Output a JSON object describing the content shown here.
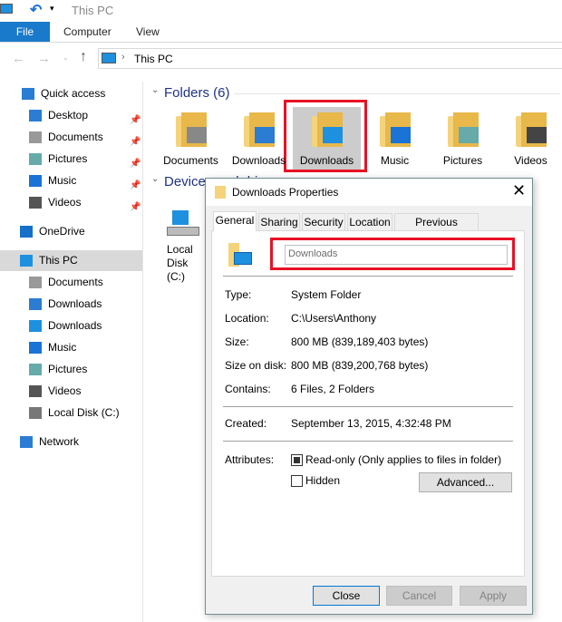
{
  "window": {
    "title": "This PC"
  },
  "ribbon": {
    "tabs": [
      "File",
      "Computer",
      "View"
    ]
  },
  "address": {
    "path": "This PC"
  },
  "nav": [
    {
      "label": "Quick access",
      "icon": "star-icon",
      "color": "#2b7cd3"
    },
    {
      "label": "Desktop",
      "icon": "desktop-arrow-icon",
      "color": "#2b7cd3",
      "pinned": true
    },
    {
      "label": "Documents",
      "icon": "documents-icon",
      "color": "#999",
      "pinned": true
    },
    {
      "label": "Pictures",
      "icon": "pictures-icon",
      "color": "#6aa",
      "pinned": true
    },
    {
      "label": "Music",
      "icon": "music-icon",
      "color": "#1a73d6",
      "pinned": true
    },
    {
      "label": "Videos",
      "icon": "videos-icon",
      "color": "#555",
      "pinned": true
    },
    {
      "label": "OneDrive",
      "icon": "cloud-icon",
      "color": "#1470c8"
    },
    {
      "label": "This PC",
      "icon": "computer-icon",
      "color": "#1e90e0",
      "selected": true
    },
    {
      "label": "Documents",
      "icon": "documents-icon",
      "color": "#999"
    },
    {
      "label": "Downloads",
      "icon": "download-icon",
      "color": "#2b7cd3"
    },
    {
      "label": "Downloads",
      "icon": "desktop-icon",
      "color": "#1e90e0"
    },
    {
      "label": "Music",
      "icon": "music-icon",
      "color": "#1a73d6"
    },
    {
      "label": "Pictures",
      "icon": "pictures-icon",
      "color": "#6aa"
    },
    {
      "label": "Videos",
      "icon": "videos-icon",
      "color": "#555"
    },
    {
      "label": "Local Disk (C:)",
      "icon": "drive-icon",
      "color": "#777"
    },
    {
      "label": "Network",
      "icon": "network-icon",
      "color": "#2b7cd3"
    }
  ],
  "main": {
    "folders_heading": "Folders (6)",
    "folders": [
      {
        "label": "Documents",
        "icon": "documents-icon",
        "color": "#888"
      },
      {
        "label": "Downloads",
        "icon": "download-icon",
        "color": "#2b7cd3"
      },
      {
        "label": "Downloads",
        "icon": "desktop-icon",
        "color": "#1e90e0",
        "selected": true
      },
      {
        "label": "Music",
        "icon": "music-icon",
        "color": "#1a73d6"
      },
      {
        "label": "Pictures",
        "icon": "pictures-icon",
        "color": "#6aa"
      },
      {
        "label": "Videos",
        "icon": "videos-icon",
        "color": "#444"
      }
    ],
    "devices_heading": "Devices and drives",
    "drive_label": "Local Disk (C:)"
  },
  "dialog": {
    "title": "Downloads Properties",
    "tabs": [
      "General",
      "Sharing",
      "Security",
      "Location",
      "Previous Versions"
    ],
    "name_value": "Downloads",
    "rows": [
      {
        "label": "Type:",
        "value": "System Folder"
      },
      {
        "label": "Location:",
        "value": "C:\\Users\\Anthony"
      },
      {
        "label": "Size:",
        "value": "800 MB (839,189,403 bytes)"
      },
      {
        "label": "Size on disk:",
        "value": "800 MB (839,200,768 bytes)"
      },
      {
        "label": "Contains:",
        "value": "6 Files, 2 Folders"
      }
    ],
    "created_label": "Created:",
    "created_value": "September 13, 2015, 4:32:48 PM",
    "attributes_label": "Attributes:",
    "readonly_label": "Read-only (Only applies to files in folder)",
    "readonly_checked": "indeterminate",
    "hidden_label": "Hidden",
    "advanced_label": "Advanced...",
    "buttons": {
      "close": "Close",
      "cancel": "Cancel",
      "apply": "Apply"
    }
  }
}
